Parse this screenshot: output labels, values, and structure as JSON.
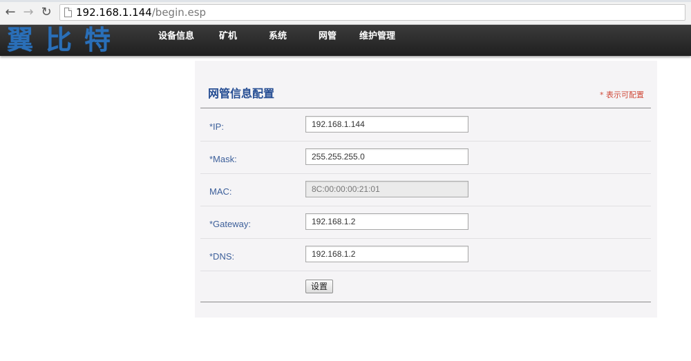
{
  "browser": {
    "url_host": "192.168.1.144",
    "url_path": "/begin.esp"
  },
  "header": {
    "logo_text": "翼比特",
    "menu": [
      "设备信息",
      "矿机",
      "系统",
      "网管",
      "维护管理"
    ]
  },
  "panel": {
    "title": "网管信息配置",
    "note": "* 表示可配置",
    "fields": [
      {
        "label": "*IP:",
        "value": "192.168.1.144",
        "editable": true
      },
      {
        "label": "*Mask:",
        "value": "255.255.255.0",
        "editable": true
      },
      {
        "label": "MAC:",
        "value": "8C:00:00:00:21:01",
        "editable": false
      },
      {
        "label": "*Gateway:",
        "value": "192.168.1.2",
        "editable": true
      },
      {
        "label": "*DNS:",
        "value": "192.168.1.2",
        "editable": true
      }
    ],
    "submit_label": "设置"
  },
  "icons": {
    "back": "arrow-left-icon",
    "forward": "arrow-right-icon",
    "reload": "reload-icon",
    "page": "document-icon"
  },
  "colors": {
    "title": "#254d93",
    "note": "#d04a3a",
    "label": "#3c5f9a",
    "logo": "#2a6fb8",
    "header_bg": "#2b2b2b"
  }
}
